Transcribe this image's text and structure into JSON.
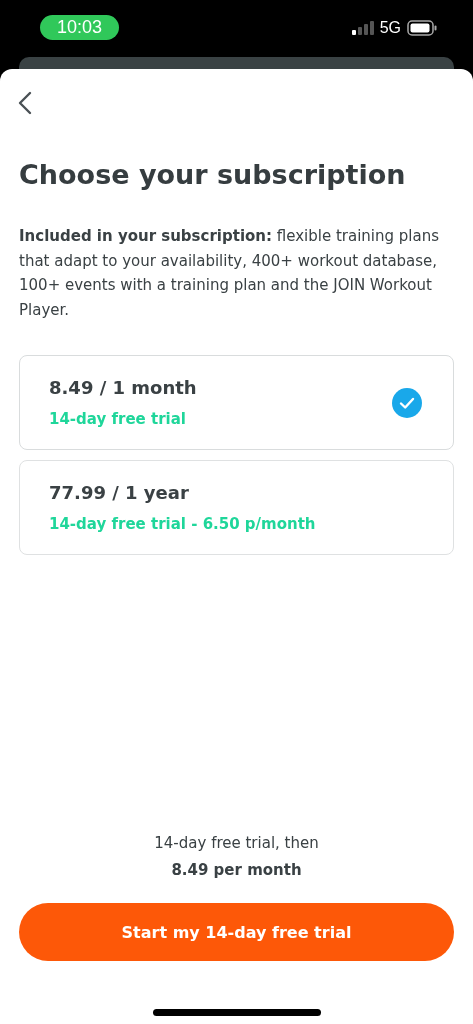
{
  "status_bar": {
    "time": "10:03",
    "network": "5G"
  },
  "title": "Choose your subscription",
  "description": "**Included in your subscription:** flexible training plans that adapt to your availability, 400+ workout database, 100+ events with a training plan and the JOIN Workout Player.",
  "plans": [
    {
      "price": "8.49 / 1 month",
      "trial": "14-day free trial",
      "selected": true
    },
    {
      "price": "77.99 / 1 year",
      "trial": "14-day free trial - 6.50 p/month",
      "selected": false
    }
  ],
  "summary": [
    "14-day free trial, then",
    "8.49 per month"
  ],
  "cta": "Start my 14-day free trial"
}
